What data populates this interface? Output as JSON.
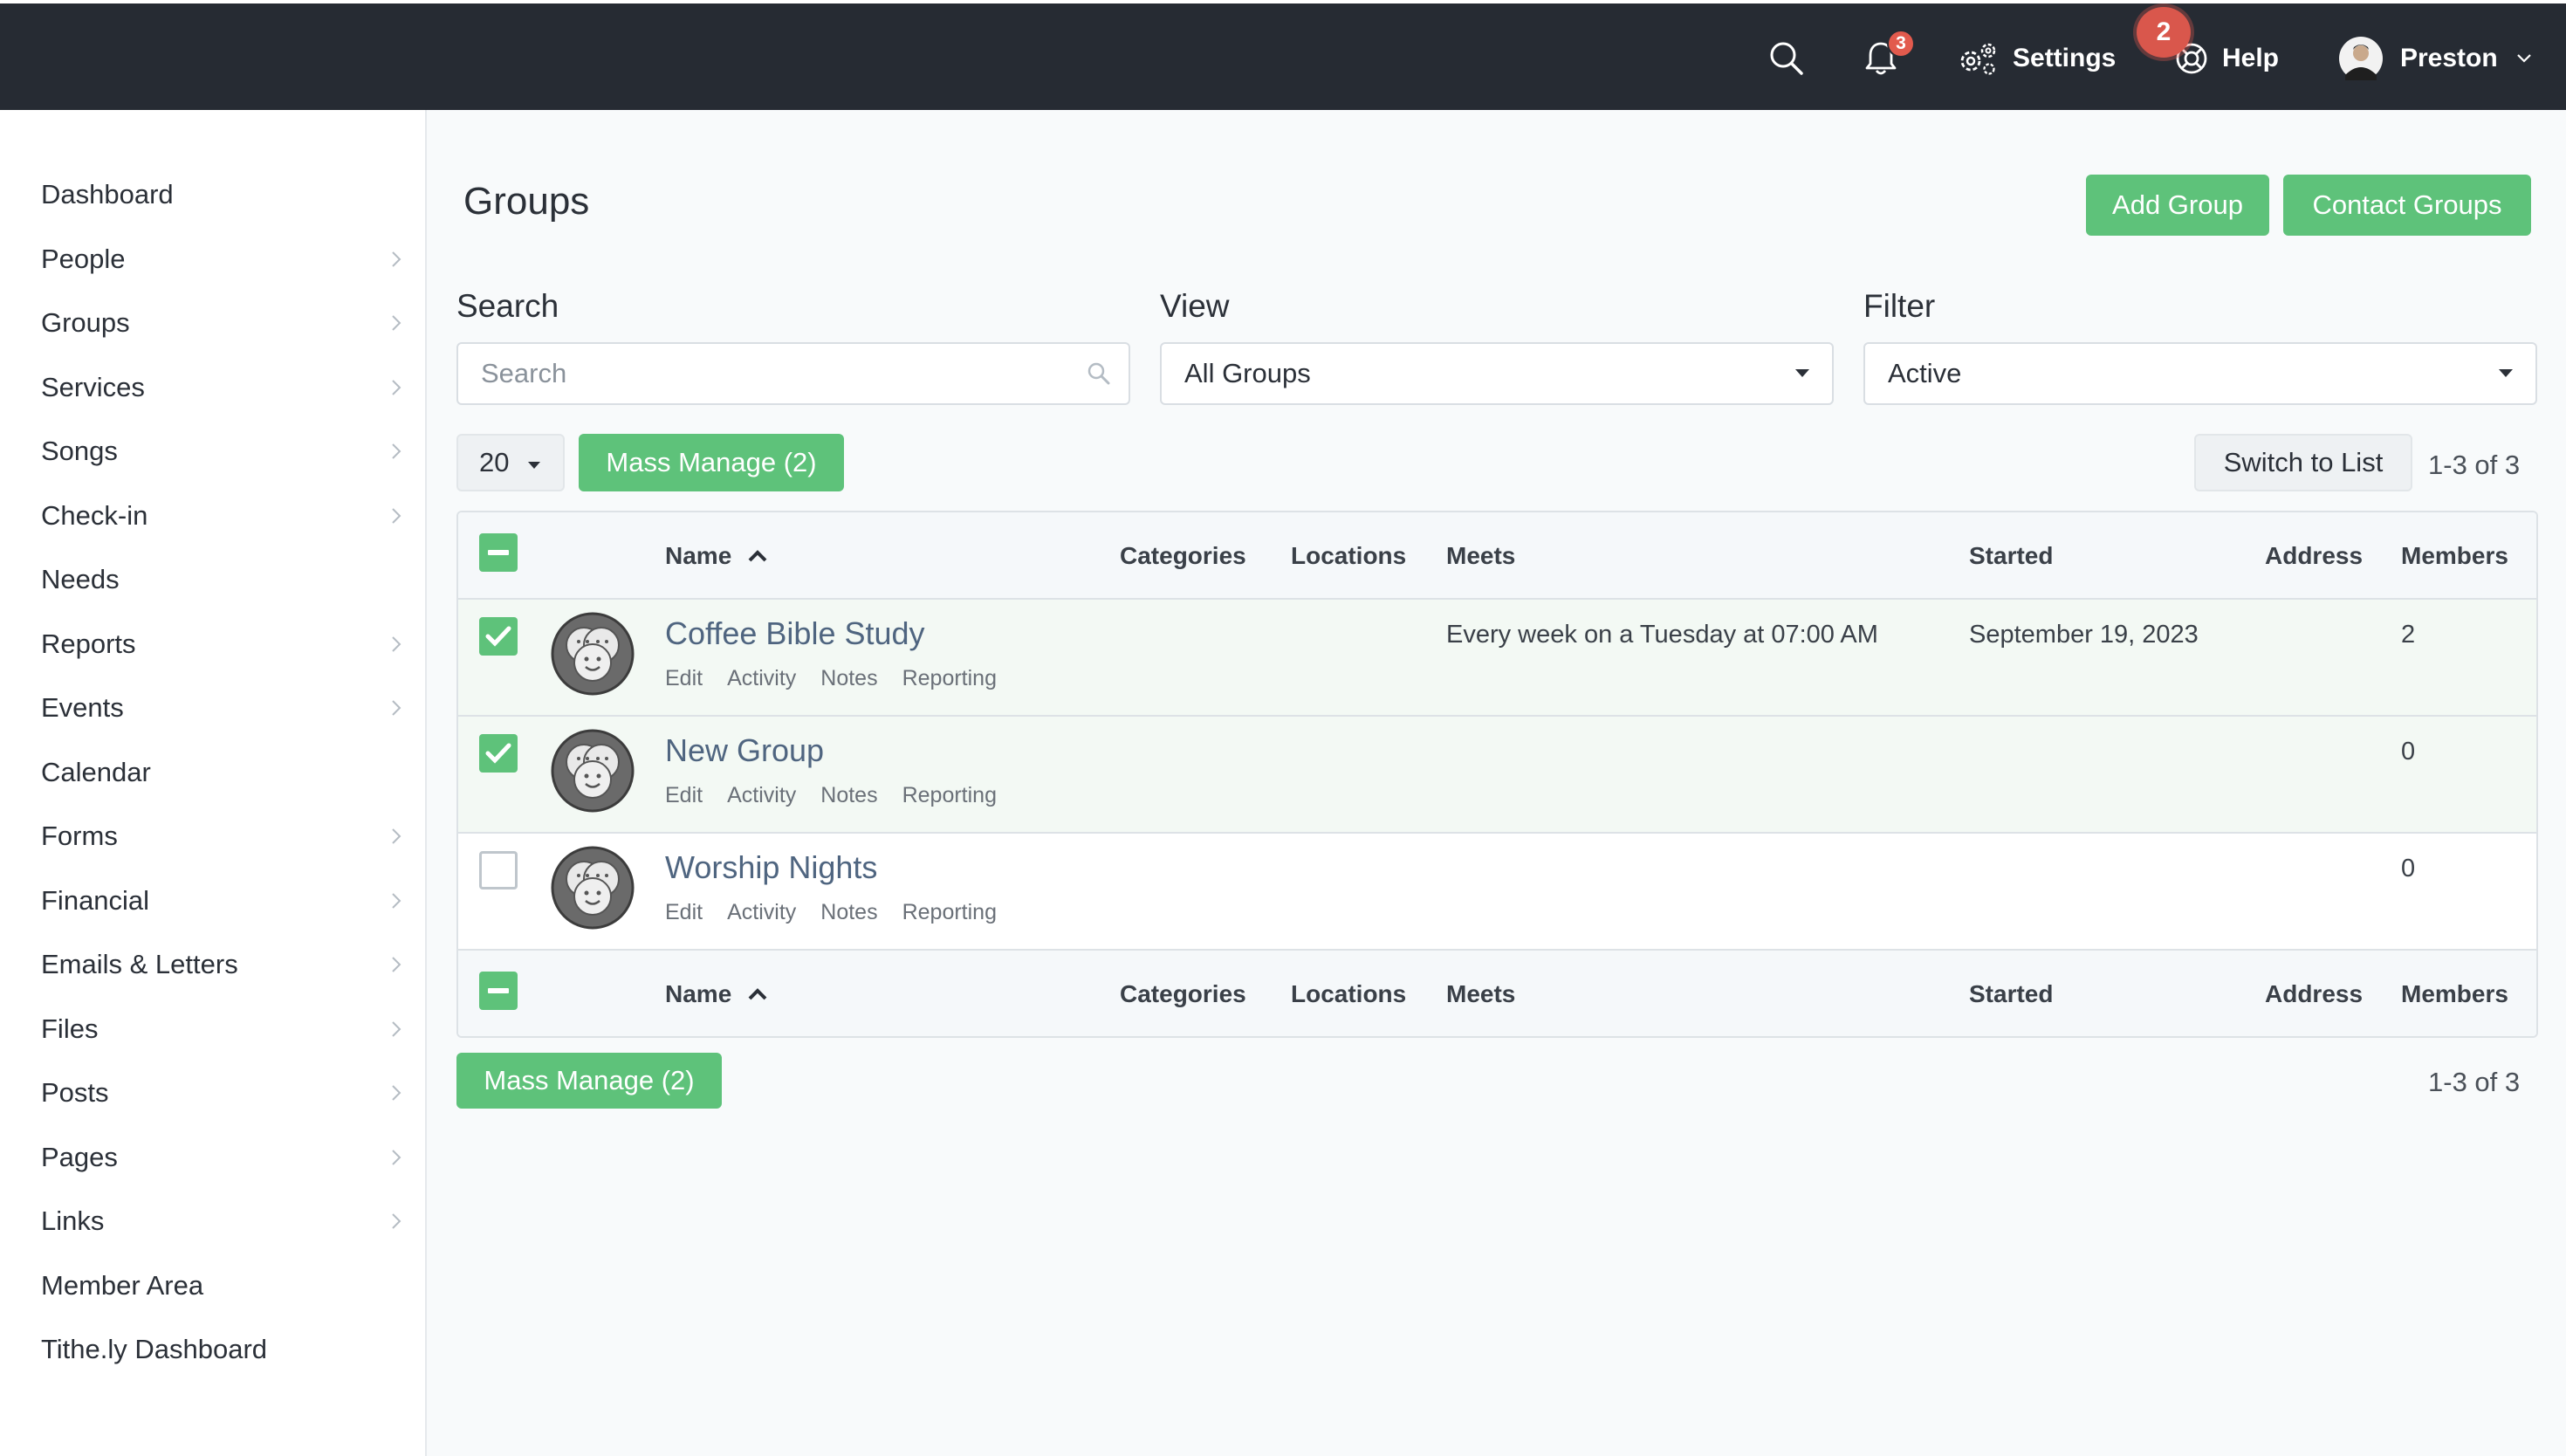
{
  "topbar": {
    "notifications_count": "3",
    "settings_label": "Settings",
    "help_badge": "2",
    "help_label": "Help",
    "user_name": "Preston",
    "icons": [
      "search-icon",
      "bell-icon",
      "gear-icon",
      "lifebuoy-icon",
      "chevron-down-icon"
    ]
  },
  "sidebar": {
    "items": [
      {
        "label": "Dashboard",
        "has_children": false
      },
      {
        "label": "People",
        "has_children": true
      },
      {
        "label": "Groups",
        "has_children": true
      },
      {
        "label": "Services",
        "has_children": true
      },
      {
        "label": "Songs",
        "has_children": true
      },
      {
        "label": "Check-in",
        "has_children": true
      },
      {
        "label": "Needs",
        "has_children": false
      },
      {
        "label": "Reports",
        "has_children": true
      },
      {
        "label": "Events",
        "has_children": true
      },
      {
        "label": "Calendar",
        "has_children": false
      },
      {
        "label": "Forms",
        "has_children": true
      },
      {
        "label": "Financial",
        "has_children": true
      },
      {
        "label": "Emails & Letters",
        "has_children": true
      },
      {
        "label": "Files",
        "has_children": true
      },
      {
        "label": "Posts",
        "has_children": true
      },
      {
        "label": "Pages",
        "has_children": true
      },
      {
        "label": "Links",
        "has_children": true
      },
      {
        "label": "Member Area",
        "has_children": false
      },
      {
        "label": "Tithe.ly Dashboard",
        "has_children": false
      }
    ]
  },
  "main": {
    "title": "Groups",
    "add_group_label": "Add Group",
    "contact_groups_label": "Contact Groups",
    "search": {
      "label": "Search",
      "placeholder": "Search"
    },
    "view": {
      "label": "View",
      "value": "All Groups"
    },
    "filter": {
      "label": "Filter",
      "value": "Active"
    },
    "per_page": "20",
    "mass_manage_label": "Mass Manage (2)",
    "switch_to_list_label": "Switch to List",
    "pagination": "1-3 of 3"
  },
  "table": {
    "columns": {
      "name": "Name",
      "categories": "Categories",
      "locations": "Locations",
      "meets": "Meets",
      "started": "Started",
      "address": "Address",
      "members": "Members"
    },
    "row_actions": [
      "Edit",
      "Activity",
      "Notes",
      "Reporting"
    ],
    "rows": [
      {
        "name": "Coffee Bible Study",
        "selected": true,
        "meets": "Every week on a Tuesday at 07:00 AM",
        "started": "September 19, 2023",
        "members": "2"
      },
      {
        "name": "New Group",
        "selected": true,
        "meets": "",
        "started": "",
        "members": "0"
      },
      {
        "name": "Worship Nights",
        "selected": false,
        "meets": "",
        "started": "",
        "members": "0"
      }
    ]
  },
  "colors": {
    "topbar": "#262b33",
    "accent_green": "#5ec27a",
    "badge_red": "#e25a4d",
    "link_blue": "#4f6580"
  }
}
